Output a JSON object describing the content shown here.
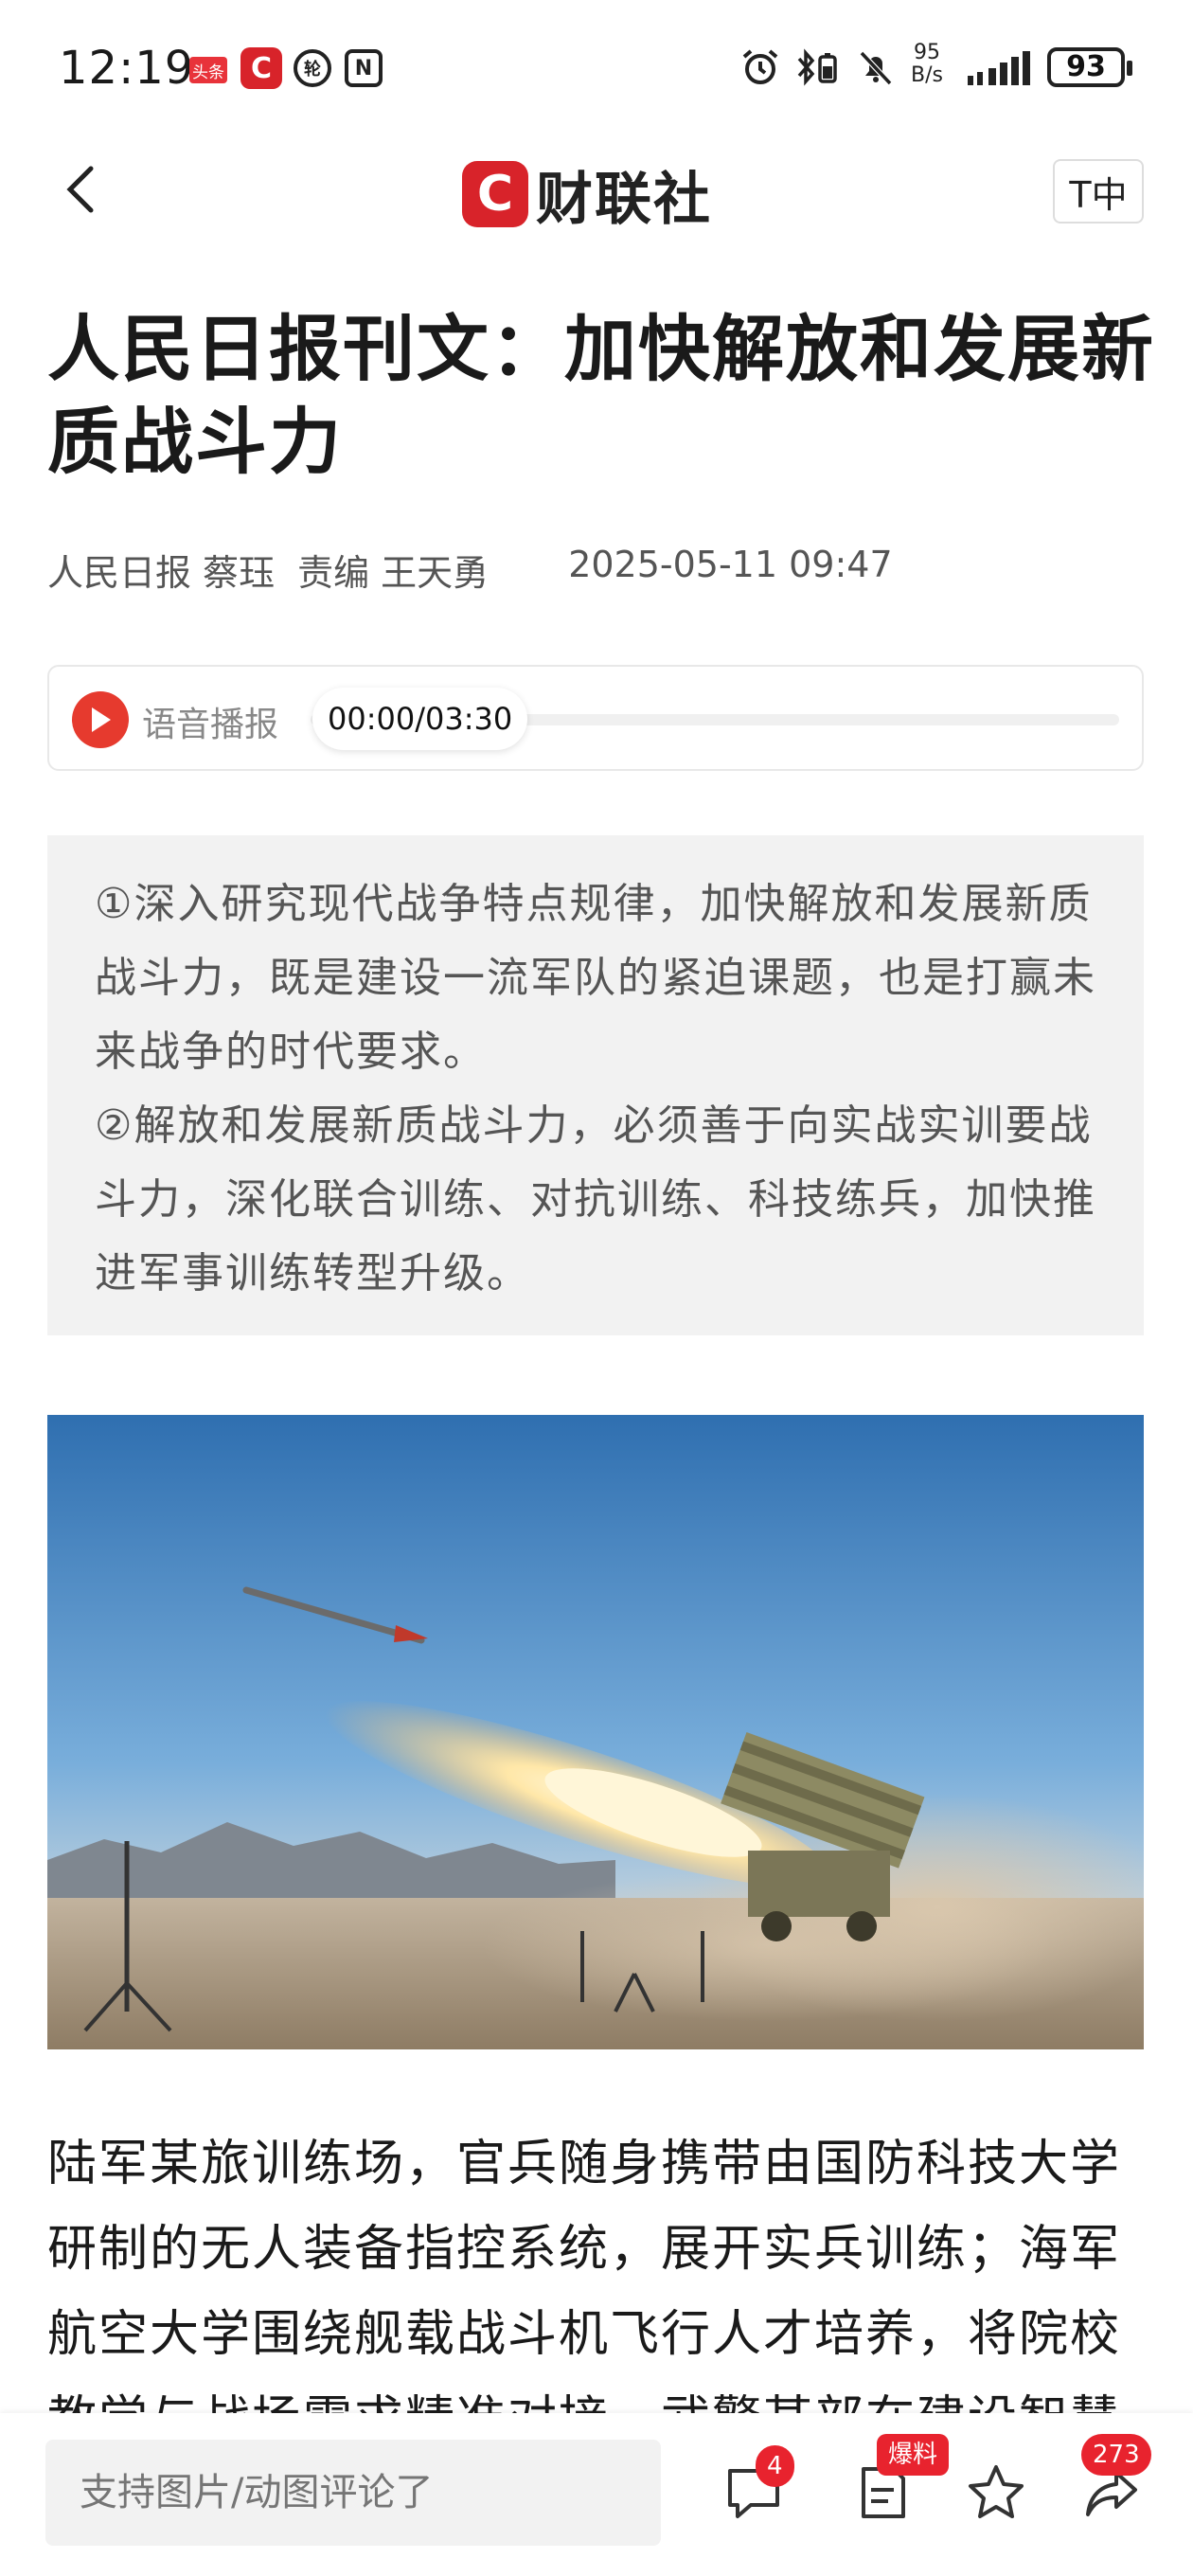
{
  "status_bar": {
    "time": "12:19",
    "toutiao_badge": "头条",
    "app_badge": "C",
    "circle_icon_text": "轮",
    "nfc_text": "N",
    "net_speed_value": "95",
    "net_speed_unit": "B/s",
    "battery": "93"
  },
  "nav": {
    "logo_mark": "C",
    "logo_text": "财联社",
    "font_size_label": "T中"
  },
  "article": {
    "title": "人民日报刊文：加快解放和发展新质战斗力",
    "source": "人民日报 蔡珏",
    "editor": "责编 王天勇",
    "datetime": "2025-05-11 09:47",
    "audio": {
      "label": "语音播报",
      "time": "00:00/03:30",
      "progress": 0
    },
    "summary": [
      "①深入研究现代战争特点规律，加快解放和发展新质战斗力，既是建设一流军队的紧迫课题，也是打赢未来战争的时代要求。",
      "②解放和发展新质战斗力，必须善于向实战实训要战斗力，深化联合训练、对抗训练、科技练兵，加快推进军事训练转型升级。"
    ],
    "body": "陆军某旅训练场，官兵随身携带由国防科技大学研制的无人装备指控系统，展开实兵训练；海军航空大学围绕舰载战斗机飞行人才培养，将院校教学与战场需求精准对接，武警某部在建设智慧"
  },
  "bottom_bar": {
    "comment_placeholder": "支持图片/动图评论了",
    "comment_count": "4",
    "report_badge": "爆料",
    "share_count": "273"
  },
  "colors": {
    "brand_red": "#d8232a",
    "badge_red": "#e8232e"
  }
}
